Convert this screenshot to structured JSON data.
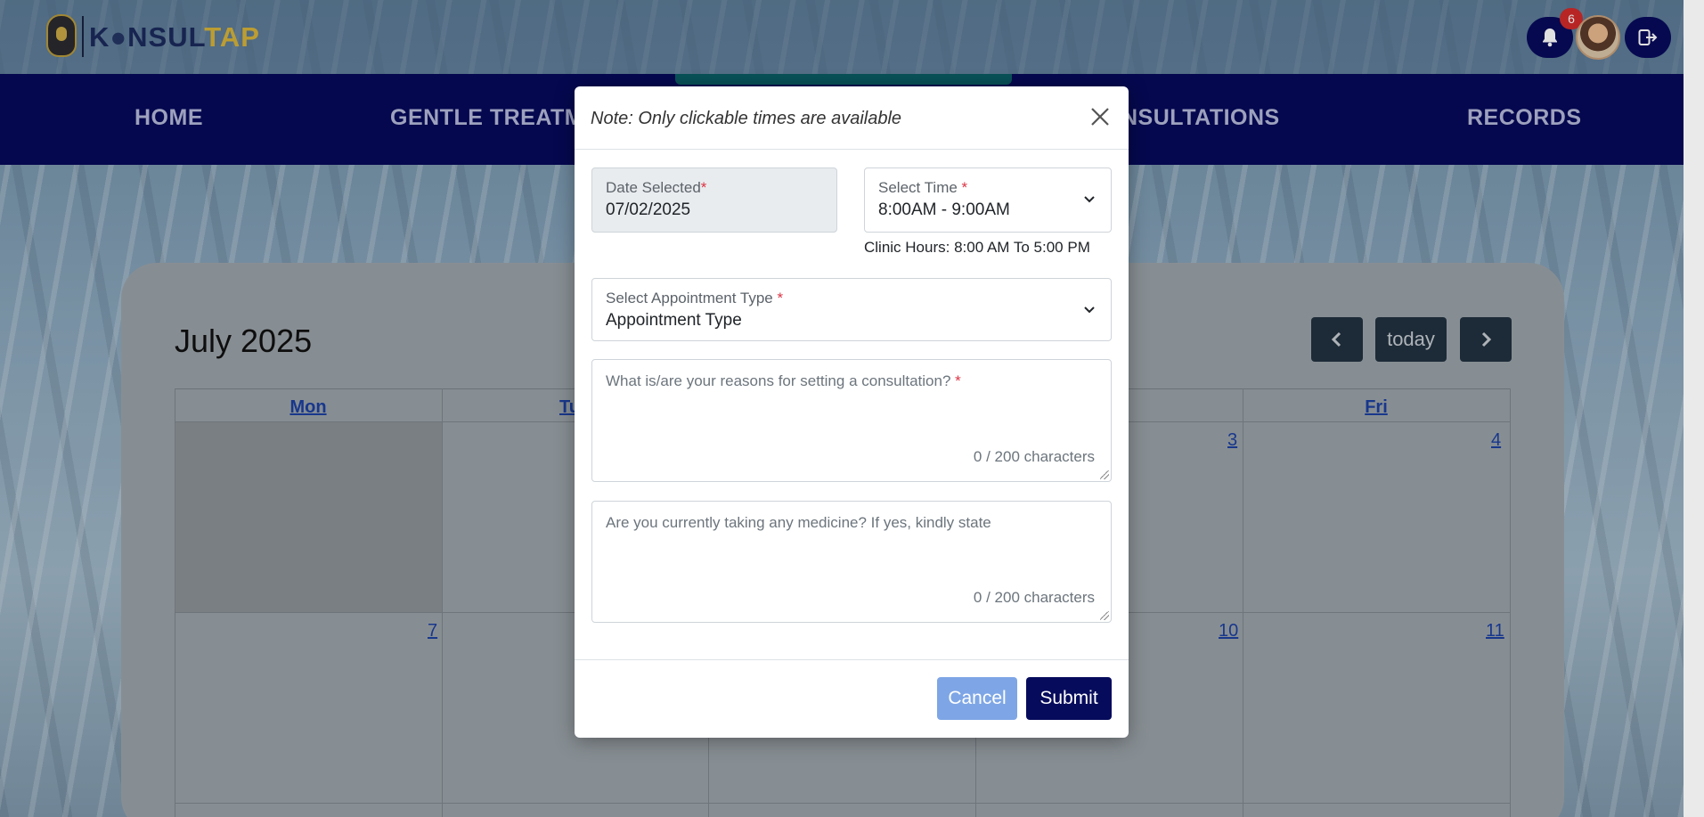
{
  "app": {
    "logo_prefix": "K",
    "logo_middle": "NSUL",
    "logo_suffix": "TAP",
    "notification_count": "6"
  },
  "nav": {
    "items": [
      "HOME",
      "GENTLE TREATME",
      "NSULTATIONS",
      "RECORDS"
    ]
  },
  "calendar": {
    "title": "July 2025",
    "today_label": "today",
    "days": [
      "Mon",
      "Tu",
      "Fri"
    ],
    "dates": [
      "3",
      "4",
      "7",
      "10",
      "11"
    ]
  },
  "modal": {
    "note": "Note: Only clickable times are available",
    "date_label": "Date Selected",
    "date_value": "07/02/2025",
    "time_label": "Select Time",
    "time_value": "8:00AM - 9:00AM",
    "clinic_hours": "Clinic Hours: 8:00 AM To 5:00 PM",
    "appt_label": "Select Appointment Type",
    "appt_value": "Appointment Type",
    "reason_placeholder": "What is/are your reasons for setting a consultation?",
    "reason_counter": "0 / 200 characters",
    "medicine_placeholder": "Are you currently taking any medicine? If yes, kindly state",
    "medicine_counter": "0 / 200 characters",
    "cancel_label": "Cancel",
    "submit_label": "Submit",
    "required_mark": "*"
  }
}
